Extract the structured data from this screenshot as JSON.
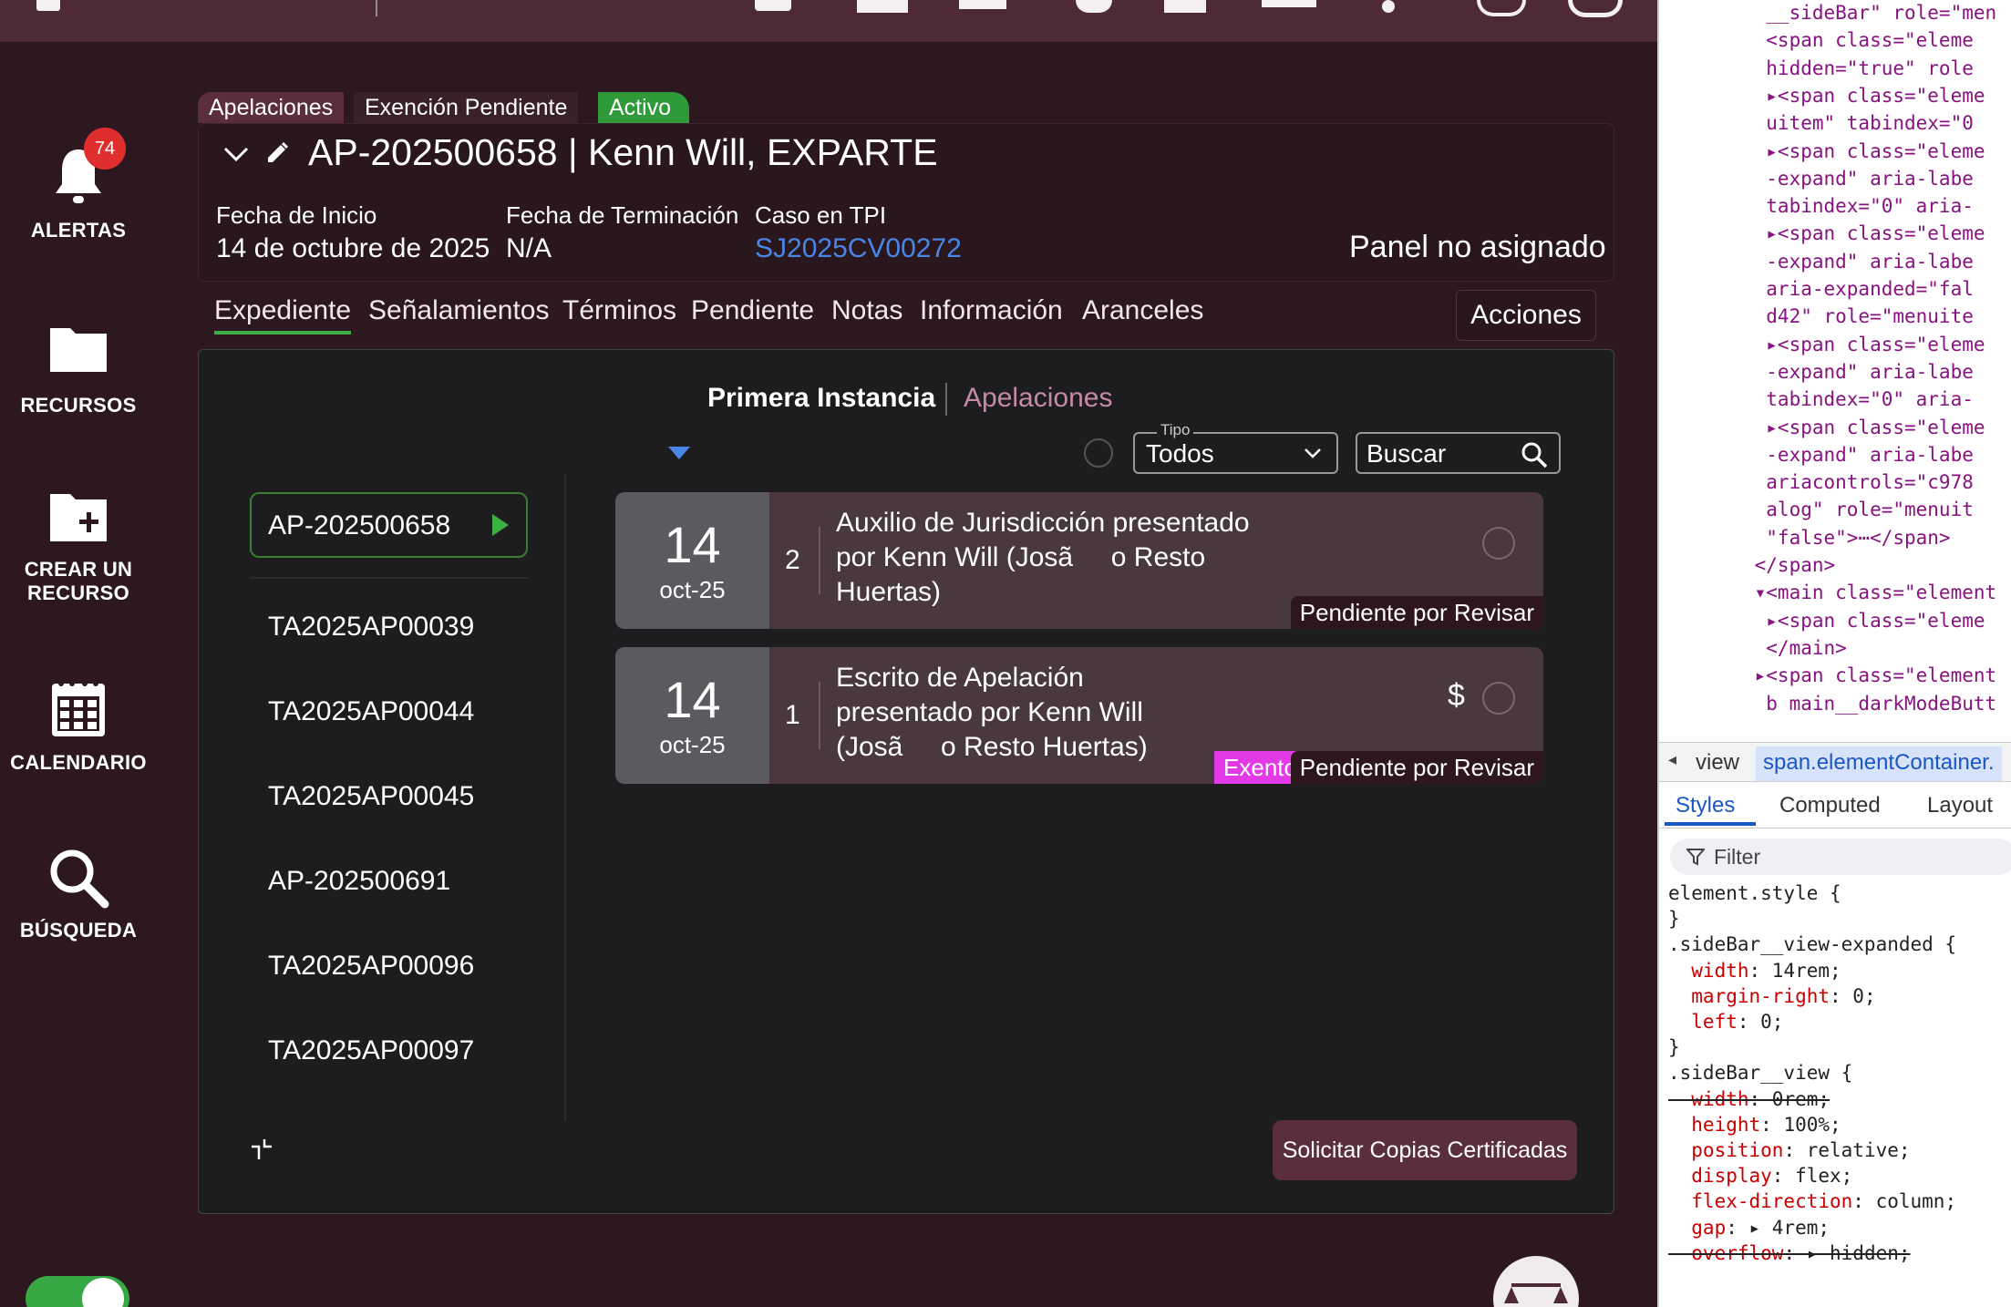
{
  "sidebar": {
    "alerts_count": "74",
    "items": [
      {
        "label": "ALERTAS"
      },
      {
        "label": "RECURSOS"
      },
      {
        "label": "CREAR UN RECURSO"
      },
      {
        "label": "CALENDARIO"
      },
      {
        "label": "BÚSQUEDA"
      }
    ]
  },
  "header": {
    "tags": [
      "Apelaciones",
      "Exención Pendiente",
      "Activo"
    ],
    "title": "AP-202500658 | Kenn Will, EXPARTE",
    "fields": [
      {
        "label": "Fecha de Inicio",
        "value": "14 de octubre de 2025"
      },
      {
        "label": "Fecha de Terminación",
        "value": "N/A"
      },
      {
        "label": "Caso en TPI",
        "value": "SJ2025CV00272"
      }
    ],
    "panel": "Panel no asignado"
  },
  "tabs": [
    "Expediente",
    "Señalamientos",
    "Términos",
    "Pendiente",
    "Notas",
    "Información",
    "Aranceles"
  ],
  "actions_label": "Acciones",
  "subtabs": [
    "Primera Instancia",
    "Apelaciones"
  ],
  "filter": {
    "type_legend": "Tipo",
    "type_value": "Todos",
    "search_placeholder": "Buscar"
  },
  "cases": [
    "AP-202500658",
    "TA2025AP00039",
    "TA2025AP00044",
    "TA2025AP00045",
    "AP-202500691",
    "TA2025AP00096",
    "TA2025AP00097"
  ],
  "entries": [
    {
      "day": "14",
      "month": "oct-25",
      "number": "2",
      "line1": "Auxilio de Jurisdicción presentado",
      "line2": "por Kenn Will (Josã     o Resto",
      "line3": "Huertas)",
      "status": "Pendiente por Revisar"
    },
    {
      "day": "14",
      "month": "oct-25",
      "number": "1",
      "line1": "Escrito de Apelación",
      "line2": "presentado por Kenn Will",
      "line3": "(Josã     o Resto Huertas)",
      "exempt": "Exento",
      "fee_symbol": "$",
      "status": "Pendiente por Revisar"
    }
  ],
  "cert_button": "Solicitar Copias Certificadas",
  "devtools": {
    "dom_lines": [
      "  __sideBar\" role=\"men",
      "  <span class=\"eleme",
      "  hidden=\"true\" role",
      "  ▸<span class=\"eleme",
      "  uitem\" tabindex=\"0",
      "  ▸<span class=\"eleme",
      "  -expand\" aria-labe",
      "  tabindex=\"0\" aria-",
      "  ▸<span class=\"eleme",
      "  -expand\" aria-labe",
      "  aria-expanded=\"fal",
      "  d42\" role=\"menuite",
      "  ▸<span class=\"eleme",
      "  -expand\" aria-labe",
      "  tabindex=\"0\" aria-",
      "  ▸<span class=\"eleme",
      "  -expand\" aria-labe",
      "  ariacontrols=\"c978",
      "  alog\" role=\"menuit",
      "  \"false\">⋯</span>",
      " </span>",
      " ▾<main class=\"element",
      "  ▸<span class=\"eleme",
      "  </main>",
      " ▸<span class=\"element",
      "  b main__darkModeButt"
    ],
    "crumbs": [
      "view",
      "span.elementContainer."
    ],
    "style_tabs": [
      "Styles",
      "Computed",
      "Layout"
    ],
    "filter_placeholder": "Filter",
    "css_lines": [
      "element.style {",
      "}",
      ".sideBar__view-expanded {",
      "  width: 14rem;",
      "  margin-right: 0;",
      "  left: 0;",
      "}",
      ".sideBar__view {",
      "  width: 0rem;",
      "  height: 100%;",
      "  position: relative;",
      "  display: flex;",
      "  flex-direction: column;",
      "  gap: ▸ 4rem;",
      "  overflow: ▸ hidden;"
    ]
  },
  "colors": {
    "background": "#2d1820",
    "accent_green": "#3cb043",
    "link_blue": "#4a86e8",
    "exempt_pink": "#e13ae6",
    "alert_red": "#e02e2e"
  }
}
